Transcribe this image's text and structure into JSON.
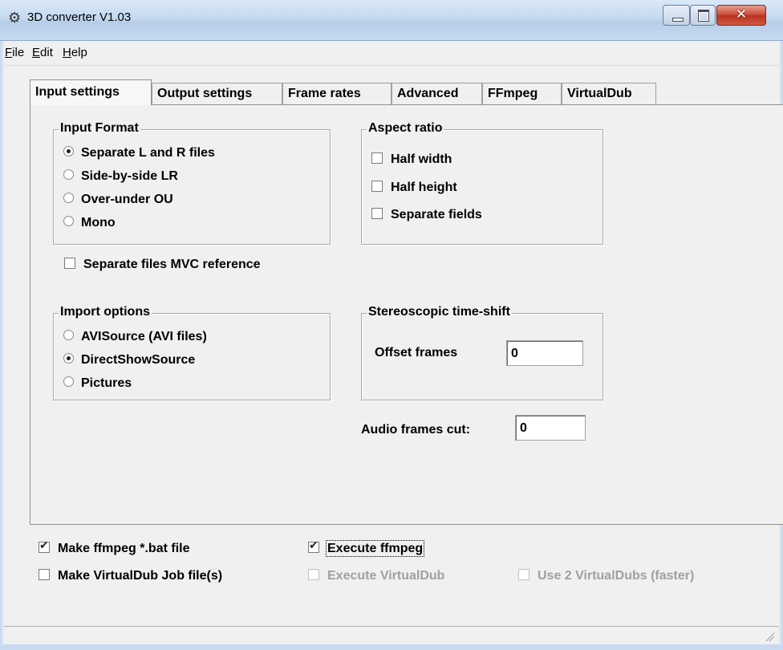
{
  "window": {
    "title": "3D converter V1.03",
    "icon": "app-gear-icon"
  },
  "menu": [
    {
      "accel": "F",
      "rest": "ile"
    },
    {
      "accel": "E",
      "rest": "dit"
    },
    {
      "accel": "H",
      "rest": "elp"
    }
  ],
  "tabs": [
    {
      "label": "Input settings",
      "active": true
    },
    {
      "label": "Output settings"
    },
    {
      "label": "Frame rates"
    },
    {
      "label": "Advanced"
    },
    {
      "label": "FFmpeg"
    },
    {
      "label": "VirtualDub"
    }
  ],
  "input_format": {
    "title": "Input Format",
    "options": [
      {
        "label": "Separate L and R files",
        "selected": true
      },
      {
        "label": "Side-by-side LR",
        "selected": false
      },
      {
        "label": "Over-under OU",
        "selected": false
      },
      {
        "label": "Mono",
        "selected": false
      }
    ]
  },
  "mvc_reference": {
    "label": "Separate files MVC reference",
    "checked": false
  },
  "aspect_ratio": {
    "title": "Aspect ratio",
    "options": [
      {
        "label": "Half width",
        "checked": false
      },
      {
        "label": "Half height",
        "checked": false
      },
      {
        "label": "Separate fields",
        "checked": false
      }
    ]
  },
  "import_options": {
    "title": "Import options",
    "options": [
      {
        "label": "AVISource (AVI files)",
        "selected": false
      },
      {
        "label": "DirectShowSource",
        "selected": true
      },
      {
        "label": "Pictures",
        "selected": false
      }
    ]
  },
  "time_shift": {
    "title": "Stereoscopic time-shift",
    "offset_label": "Offset frames",
    "offset_value": "0"
  },
  "audio_cut": {
    "label": "Audio frames cut:",
    "value": "0"
  },
  "bottom": {
    "make_ffmpeg": {
      "label": "Make ffmpeg *.bat file",
      "checked": true
    },
    "execute_ffmpeg": {
      "label": "Execute ffmpeg",
      "checked": true
    },
    "make_vdub": {
      "label": "Make VirtualDub Job file(s)",
      "checked": false
    },
    "execute_vdub": {
      "label": "Execute VirtualDub",
      "checked": false,
      "disabled": true
    },
    "two_vdubs": {
      "label": "Use 2 VirtualDubs (faster)",
      "checked": false,
      "disabled": true
    }
  }
}
